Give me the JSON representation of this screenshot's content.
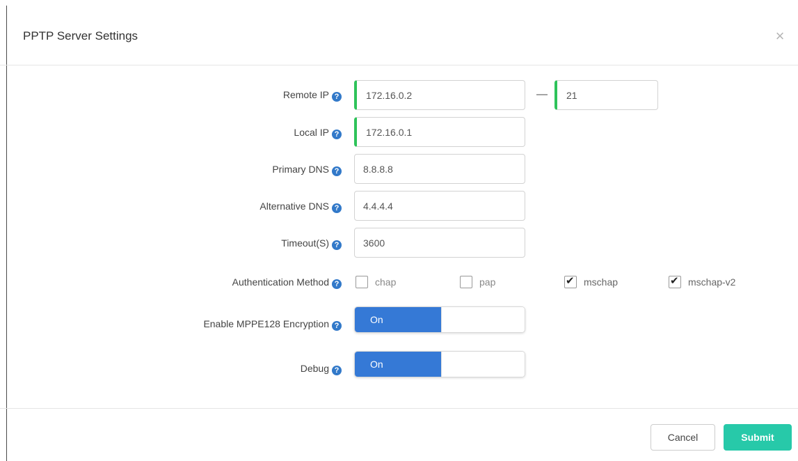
{
  "dialog": {
    "title": "PPTP Server Settings",
    "close_glyph": "×"
  },
  "form": {
    "remote_ip": {
      "label": "Remote IP",
      "start_value": "172.16.0.2",
      "separator": "—",
      "end_value": "21"
    },
    "local_ip": {
      "label": "Local IP",
      "value": "172.16.0.1"
    },
    "primary_dns": {
      "label": "Primary DNS",
      "value": "8.8.8.8"
    },
    "alternative_dns": {
      "label": "Alternative DNS",
      "value": "4.4.4.4"
    },
    "timeout": {
      "label": "Timeout(S)",
      "value": "3600"
    },
    "auth_method": {
      "label": "Authentication Method",
      "options": [
        {
          "label": "chap",
          "checked": false
        },
        {
          "label": "pap",
          "checked": false
        },
        {
          "label": "mschap",
          "checked": true
        },
        {
          "label": "mschap-v2",
          "checked": true
        }
      ]
    },
    "mppe": {
      "label": "Enable MPPE128 Encryption",
      "state_text": "On"
    },
    "debug": {
      "label": "Debug",
      "state_text": "On"
    },
    "help_glyph": "?",
    "check_glyph": "✔"
  },
  "footer": {
    "cancel_label": "Cancel",
    "submit_label": "Submit"
  },
  "colors": {
    "accent_blue": "#3579d6",
    "submit_teal": "#27c9a9",
    "valid_green": "#2ec35a",
    "help_icon": "#3279c9"
  },
  "icons": {
    "close": "close-icon",
    "help": "help-circle-icon",
    "check": "checkmark-icon"
  }
}
